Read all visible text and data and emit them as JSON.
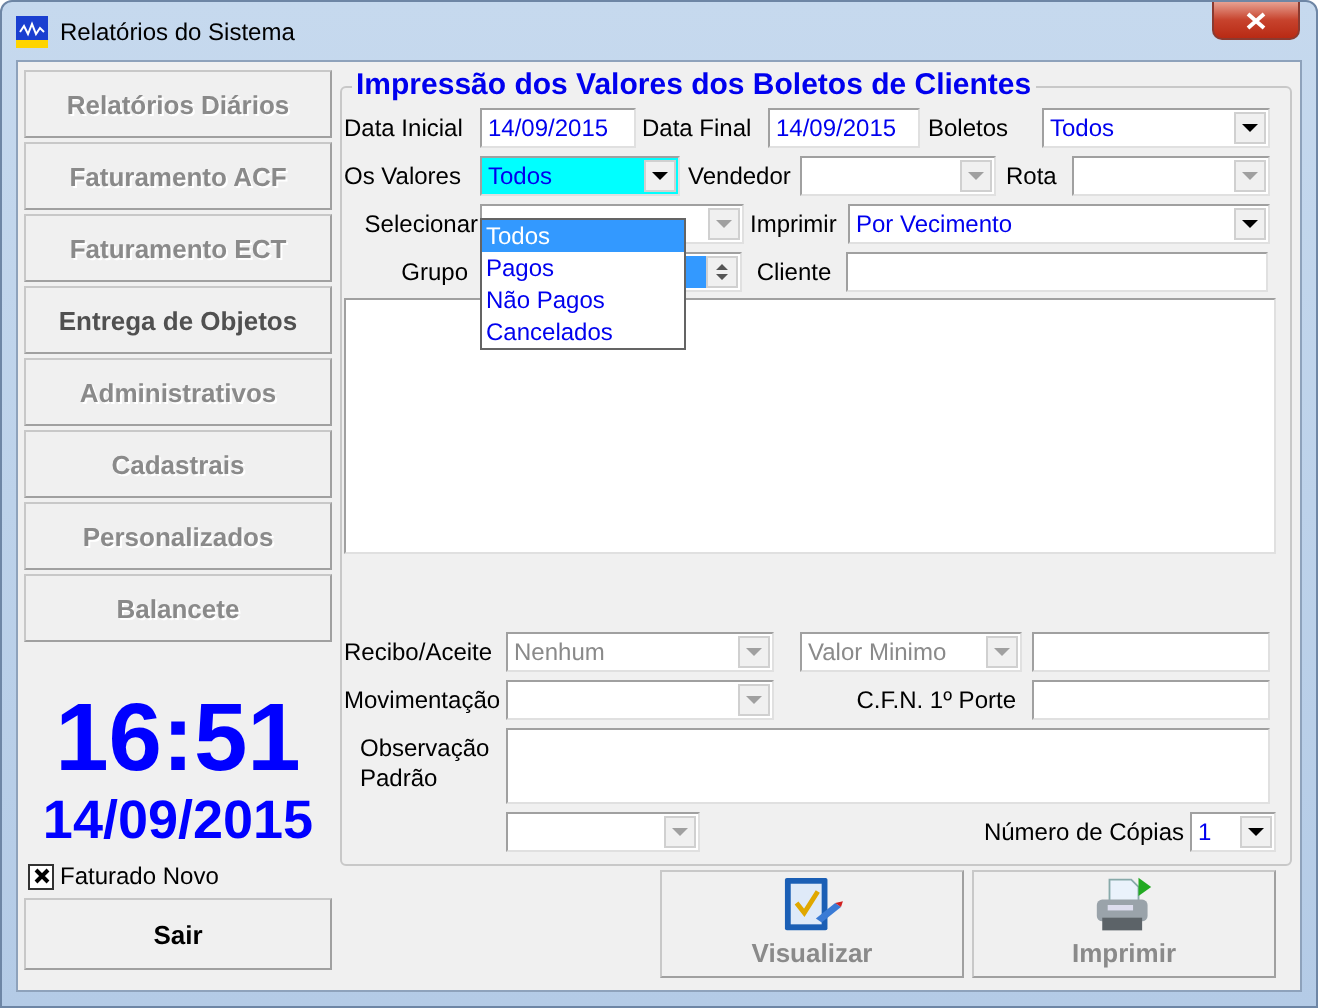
{
  "window": {
    "title": "Relatórios do Sistema"
  },
  "sidebar": {
    "items": [
      {
        "label": "Relatórios Diários",
        "disabled": true
      },
      {
        "label": "Faturamento ACF",
        "disabled": true
      },
      {
        "label": "Faturamento ECT",
        "disabled": true
      },
      {
        "label": "Entrega de Objetos",
        "disabled": false
      },
      {
        "label": "Administrativos",
        "disabled": true
      },
      {
        "label": "Cadastrais",
        "disabled": true
      },
      {
        "label": "Personalizados",
        "disabled": true
      },
      {
        "label": "Balancete",
        "disabled": true
      }
    ],
    "clock": {
      "time": "16:51",
      "date": "14/09/2015"
    },
    "faturado_novo": {
      "label": "Faturado Novo",
      "checked": true
    },
    "exit_button": {
      "label": "Sair",
      "disabled": false
    }
  },
  "form": {
    "title": "Impressão dos Valores dos Boletos de Clientes",
    "data_inicial": {
      "label": "Data Inicial",
      "value": "14/09/2015"
    },
    "data_final": {
      "label": "Data Final",
      "value": "14/09/2015"
    },
    "boletos": {
      "label": "Boletos",
      "value": "Todos",
      "disabled": false
    },
    "os_valores": {
      "label": "Os Valores",
      "value": "Todos",
      "disabled": false,
      "focused": true
    },
    "vendedor": {
      "label": "Vendedor",
      "disabled": true
    },
    "rota": {
      "label": "Rota",
      "disabled": true
    },
    "selecionar": {
      "label": "Selecionar",
      "disabled": true
    },
    "imprimir": {
      "label": "Imprimir",
      "value": "Por Vecimento",
      "disabled": false
    },
    "grupo": {
      "label": "Grupo"
    },
    "cliente": {
      "label": "Cliente"
    },
    "recibo_aceite": {
      "label": "Recibo/Aceite",
      "value": "Nenhum",
      "disabled": true
    },
    "valor_minimo": {
      "value": "Valor Minimo",
      "disabled": true
    },
    "movimentacao": {
      "label": "Movimentação",
      "disabled": true
    },
    "cfn_porte": {
      "label": "C.F.N. 1º Porte"
    },
    "observacao": {
      "label": "Observação Padrão"
    },
    "combo_extra": {
      "disabled": true
    },
    "copias": {
      "label": "Número de Cópias",
      "value": "1",
      "disabled": false
    },
    "dropdown": {
      "items": [
        {
          "label": "Todos",
          "selected": true
        },
        {
          "label": "Pagos",
          "selected": false
        },
        {
          "label": "Não Pagos",
          "selected": false
        },
        {
          "label": "Cancelados",
          "selected": false
        }
      ]
    }
  },
  "buttons": [
    {
      "kind": "preview",
      "label": "Visualizar",
      "disabled": true
    },
    {
      "kind": "print",
      "label": "Imprimir",
      "disabled": true
    }
  ]
}
